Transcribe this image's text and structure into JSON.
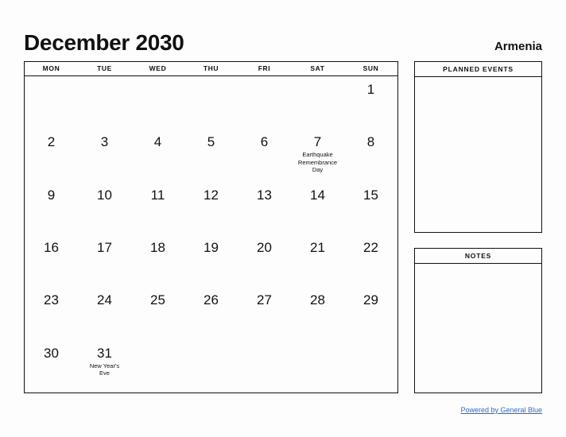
{
  "header": {
    "title": "December 2030",
    "country": "Armenia"
  },
  "calendar": {
    "day_headers": [
      "MON",
      "TUE",
      "WED",
      "THU",
      "FRI",
      "SAT",
      "SUN"
    ],
    "weeks": [
      [
        {
          "day": ""
        },
        {
          "day": ""
        },
        {
          "day": ""
        },
        {
          "day": ""
        },
        {
          "day": ""
        },
        {
          "day": ""
        },
        {
          "day": "1"
        }
      ],
      [
        {
          "day": "2"
        },
        {
          "day": "3"
        },
        {
          "day": "4"
        },
        {
          "day": "5"
        },
        {
          "day": "6"
        },
        {
          "day": "7",
          "events": [
            "Earthquake",
            "Remembrance",
            "Day"
          ]
        },
        {
          "day": "8"
        }
      ],
      [
        {
          "day": "9"
        },
        {
          "day": "10"
        },
        {
          "day": "11"
        },
        {
          "day": "12"
        },
        {
          "day": "13"
        },
        {
          "day": "14"
        },
        {
          "day": "15"
        }
      ],
      [
        {
          "day": "16"
        },
        {
          "day": "17"
        },
        {
          "day": "18"
        },
        {
          "day": "19"
        },
        {
          "day": "20"
        },
        {
          "day": "21"
        },
        {
          "day": "22"
        }
      ],
      [
        {
          "day": "23"
        },
        {
          "day": "24"
        },
        {
          "day": "25"
        },
        {
          "day": "26"
        },
        {
          "day": "27"
        },
        {
          "day": "28"
        },
        {
          "day": "29"
        }
      ],
      [
        {
          "day": "30"
        },
        {
          "day": "31",
          "events": [
            "New Year's",
            "Eve"
          ]
        },
        {
          "day": ""
        },
        {
          "day": ""
        },
        {
          "day": ""
        },
        {
          "day": ""
        },
        {
          "day": ""
        }
      ]
    ]
  },
  "panels": {
    "planned_events": {
      "title": "PLANNED EVENTS",
      "content": ""
    },
    "notes": {
      "title": "NOTES",
      "content": ""
    }
  },
  "footer": {
    "link_label": "Powered by General Blue"
  },
  "colors": {
    "background": "#fdfdfd",
    "text": "#111111",
    "border": "#111111",
    "link": "#2b6cc4"
  }
}
